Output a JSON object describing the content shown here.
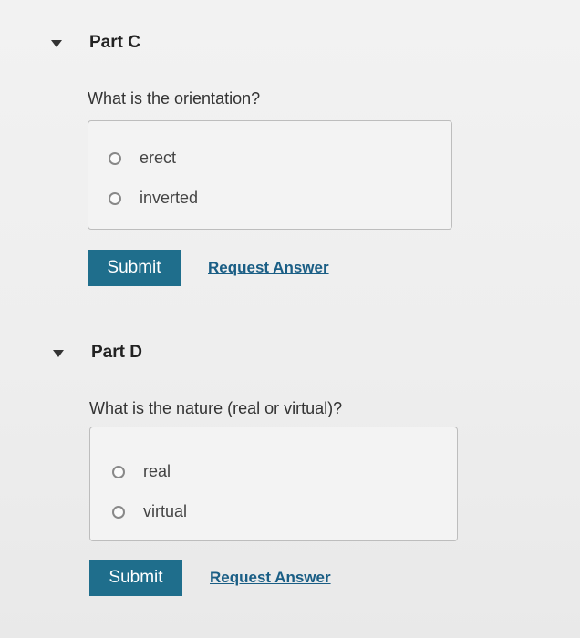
{
  "parts": [
    {
      "title": "Part C",
      "question": "What is the orientation?",
      "options": [
        "erect",
        "inverted"
      ],
      "submit_label": "Submit",
      "request_label": "Request Answer"
    },
    {
      "title": "Part D",
      "question": "What is the nature (real or virtual)?",
      "options": [
        "real",
        "virtual"
      ],
      "submit_label": "Submit",
      "request_label": "Request Answer"
    }
  ],
  "colors": {
    "submit_bg": "#1f6e8c",
    "link": "#1a5e85"
  }
}
